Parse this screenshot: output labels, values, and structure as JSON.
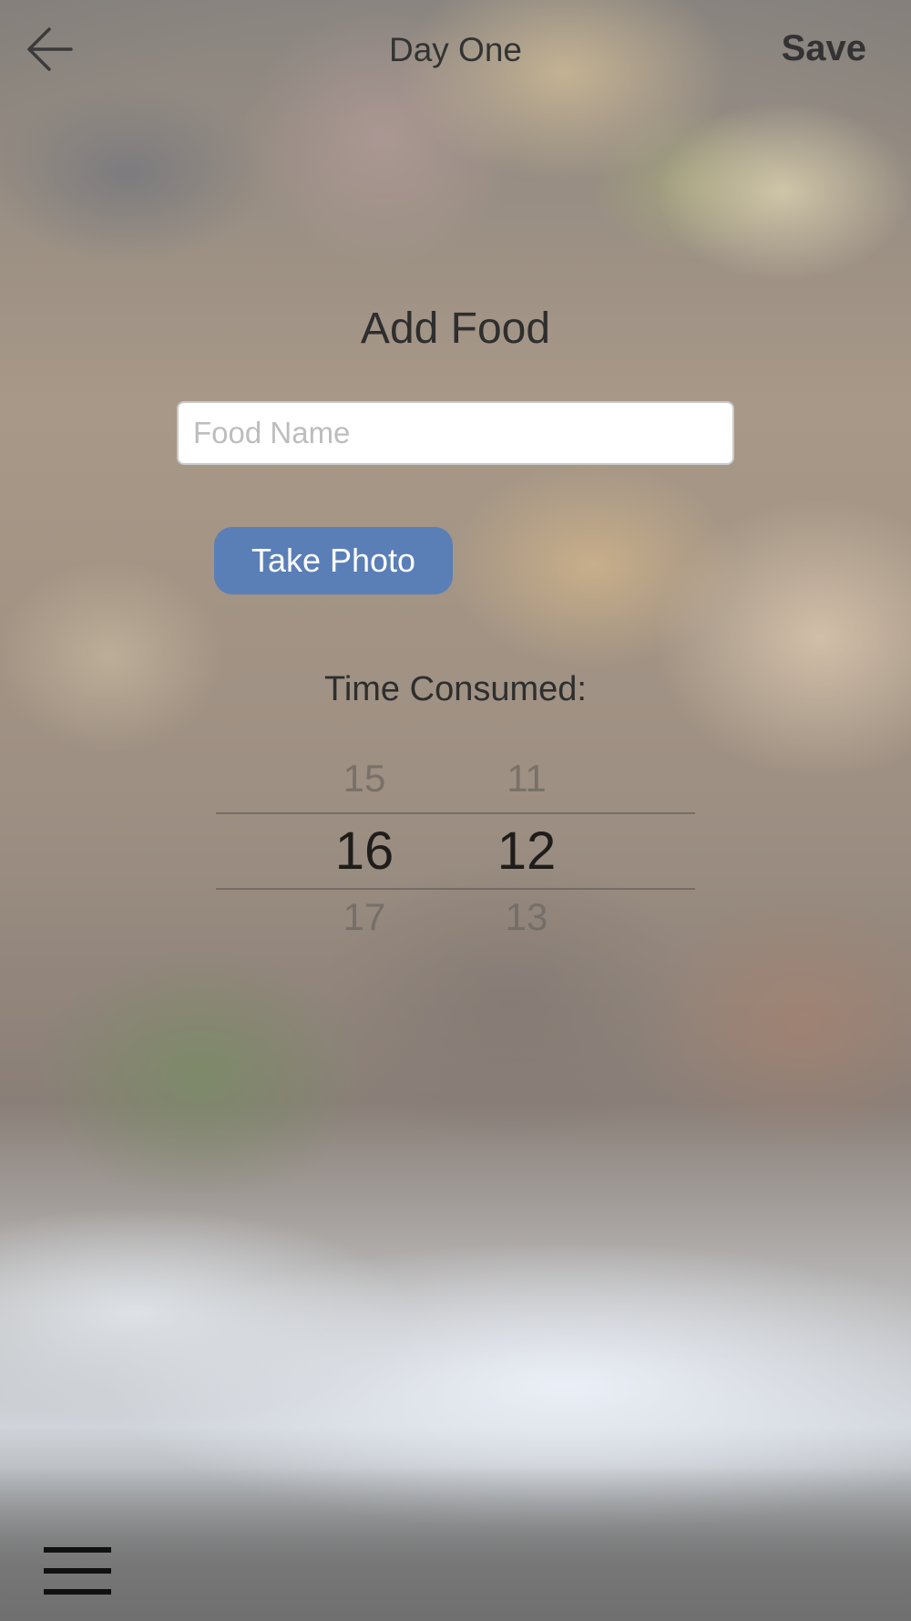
{
  "nav": {
    "title": "Day One",
    "save_label": "Save"
  },
  "form": {
    "heading": "Add Food",
    "food_name": {
      "value": "",
      "placeholder": "Food Name"
    },
    "take_photo_label": "Take Photo",
    "time_label": "Time Consumed:"
  },
  "time_picker": {
    "hour": {
      "prev": "15",
      "selected": "16",
      "next": "17"
    },
    "minute": {
      "prev": "11",
      "selected": "12",
      "next": "13"
    }
  },
  "icons": {
    "back": "back-arrow-icon",
    "menu": "hamburger-menu-icon"
  },
  "colors": {
    "primary_button": "#5a7fb7",
    "text": "#333333"
  }
}
